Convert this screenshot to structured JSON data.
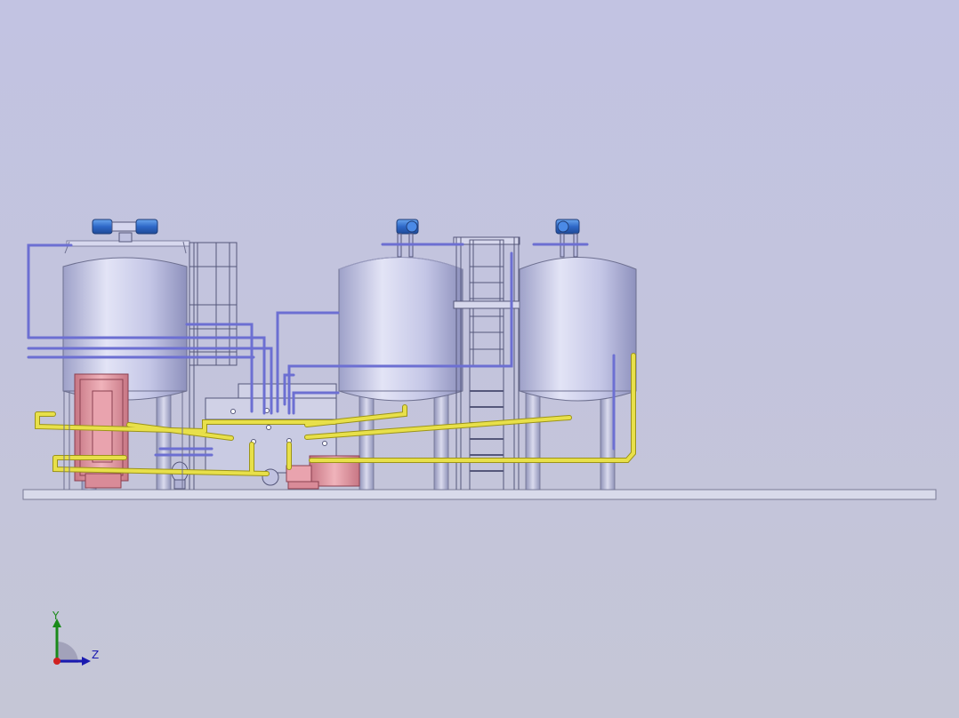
{
  "viewport": {
    "background_top": "#c2c3e2",
    "background_bottom": "#c5c6d6"
  },
  "colors": {
    "tank_steel": "#c9cbeb",
    "pipe_blue": "#6c6fd2",
    "pipe_yellow": "#e8e04a",
    "exchanger_pink": "#e39aa5",
    "motor_blue": "#3b78d8",
    "base_plate": "#d8daea",
    "frame_gray": "#8f90a8"
  },
  "components": {
    "tanks": [
      "tank-left",
      "tank-middle",
      "tank-right"
    ],
    "motors": [
      "agitator-motor-left",
      "agitator-motor-middle",
      "agitator-motor-right"
    ]
  },
  "triad": {
    "y_label": "Y",
    "z_label": "Z",
    "y_color": "#1a8a1a",
    "z_color": "#1a1ab0",
    "origin_color": "#d02020"
  }
}
